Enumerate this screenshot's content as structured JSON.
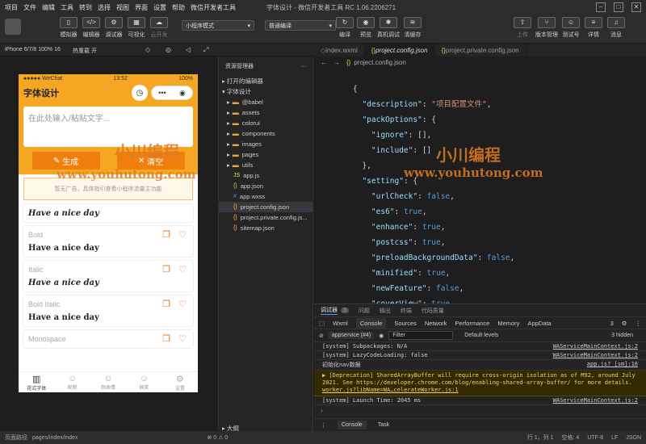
{
  "menu": [
    "项目",
    "文件",
    "编辑",
    "工具",
    "转到",
    "选择",
    "视图",
    "界面",
    "设置",
    "帮助",
    "微信开发者工具"
  ],
  "window_title": "字体设计 - 微信开发者工具 RC 1.06.2206271",
  "toolbar": {
    "simulator": "模拟器",
    "editor": "编辑器",
    "debugger": "调试器",
    "visual": "可视化",
    "cloud": "云开发",
    "mode": "小程序模式",
    "compile_mode": "普通编译",
    "compile": "编译",
    "preview": "预览",
    "real_debug": "真机调试",
    "clear_cache": "清缓存",
    "upload": "上传",
    "version": "版本管理",
    "test": "测试号",
    "detail": "详情",
    "message": "消息"
  },
  "device": {
    "model": "iPhone 6/7/8 100% 16",
    "hotreload": "热重载 开"
  },
  "phone": {
    "carrier": "●●●●● WeChat",
    "time": "13:52",
    "battery": "100%",
    "title": "字体设计",
    "input_placeholder": "在此处输入/粘贴文字...",
    "generate": "生成",
    "clear": "清空",
    "tip": "暂无广告，具体指引查看小程序流量主功能",
    "fonts": [
      {
        "name": "",
        "sample": "Have a nice day"
      },
      {
        "name": "Bold",
        "sample": "Have a nice day"
      },
      {
        "name": "Italic",
        "sample": "Have a nice day"
      },
      {
        "name": "Bold Italic",
        "sample": "Have a nice day"
      },
      {
        "name": "Monospace",
        "sample": ""
      }
    ],
    "tabs": [
      "花式字体",
      "昵称",
      "颜表情",
      "搞笑",
      "设置"
    ]
  },
  "explorer": {
    "title": "资源管理器",
    "open_editors": "打开的编辑器",
    "project": "字体设计",
    "items": [
      {
        "name": "@babel",
        "type": "folder"
      },
      {
        "name": "assets",
        "type": "folder"
      },
      {
        "name": "colorui",
        "type": "folder"
      },
      {
        "name": "components",
        "type": "folder"
      },
      {
        "name": "images",
        "type": "folder"
      },
      {
        "name": "pages",
        "type": "folder"
      },
      {
        "name": "utils",
        "type": "folder"
      },
      {
        "name": "app.js",
        "type": "js"
      },
      {
        "name": "app.json",
        "type": "json"
      },
      {
        "name": "app.wxss",
        "type": "css"
      },
      {
        "name": "project.config.json",
        "type": "json"
      },
      {
        "name": "project.private.config.js...",
        "type": "json"
      },
      {
        "name": "sitemap.json",
        "type": "json"
      }
    ],
    "outline": "大纲"
  },
  "editor": {
    "tabs": [
      "index.wxml",
      "project.config.json",
      "project.private.config.json"
    ],
    "breadcrumb": "project.config.json",
    "lines": [
      "{",
      "  \"description\": \"项目配置文件\",",
      "  \"packOptions\": {",
      "    \"ignore\": [],",
      "    \"include\": []",
      "  },",
      "  \"setting\": {",
      "    \"urlCheck\": false,",
      "    \"es6\": true,",
      "    \"enhance\": true,",
      "    \"postcss\": true,",
      "    \"preloadBackgroundData\": false,",
      "    \"minified\": true,",
      "    \"newFeature\": false,",
      "    \"coverView\": true,"
    ]
  },
  "devtools": {
    "tabs": [
      "调试器",
      "问题",
      "输出",
      "终端",
      "代码质量"
    ],
    "debug_count": "3",
    "panel_tabs": [
      "Wxml",
      "Console",
      "Sources",
      "Network",
      "Performance",
      "Memory",
      "AppData"
    ],
    "warn_count": "3",
    "context": "appservice (#4)",
    "filter": "Filter",
    "levels": "Default levels",
    "hidden": "3 hidden",
    "logs": [
      {
        "text": "[system] Subpackages: N/A",
        "src": "WAServiceMainContext.js:2"
      },
      {
        "text": "[system] LazyCodeLoading: false",
        "src": "WAServiceMainContext.js:2"
      },
      {
        "text": "初始化nav数据",
        "src": "app.js? [sm]:16"
      }
    ],
    "warning": "▶ [Deprecation] SharedArrayBuffer will require cross-origin isolation as of M92, around July 2021. See https://developer.chrome.com/blog/enabling-shared-array-buffer/ for more details.",
    "warning_src": "worker.js?libName=WA…celerateWorker.js:1",
    "launch": {
      "text": "[system] Launch Time: 2045 ms",
      "src": "WAServiceMainContext.js:2"
    },
    "bottom_tabs": [
      "Console",
      "Task"
    ]
  },
  "statusbar": {
    "path_label": "页面路径",
    "path": "pages/index/index",
    "errors": "0 ⚠ 0",
    "position": "行 1，列 1",
    "spaces": "空格: 4",
    "encoding": "UTF-8",
    "eol": "LF",
    "lang": "JSON"
  },
  "watermark": {
    "text": "小川编程",
    "url": "www.youhutong.com"
  }
}
